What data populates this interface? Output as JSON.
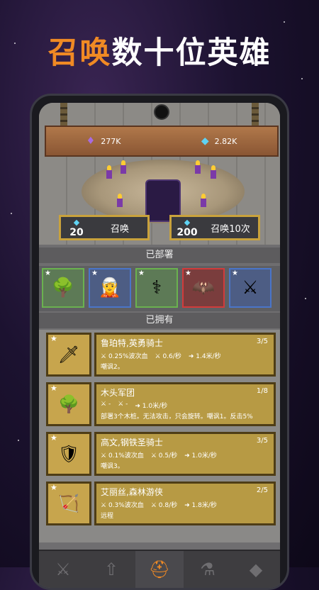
{
  "headline": {
    "accent": "召唤",
    "rest": "数十位英雄"
  },
  "resources": {
    "purple_value": "277K",
    "gem_value": "2.82K"
  },
  "summon": [
    {
      "cost": "20",
      "label": "召唤"
    },
    {
      "cost": "200",
      "label": "召唤10次"
    }
  ],
  "sections": {
    "deployed": "已部署",
    "owned": "已拥有"
  },
  "deployed_slots": [
    {
      "icon": "🌳",
      "border": "#6ab24f",
      "bg": "#5d7a56"
    },
    {
      "icon": "🧝",
      "border": "#4a75c9",
      "bg": "#4d5d84"
    },
    {
      "icon": "⚕",
      "border": "#6ab24f",
      "bg": "#5d7a56"
    },
    {
      "icon": "🦇",
      "border": "#d13b3b",
      "bg": "#7a3d3d"
    },
    {
      "icon": "⚔",
      "border": "#4a75c9",
      "bg": "#4d5d84"
    }
  ],
  "heroes": [
    {
      "icon": "🗡",
      "name": "鲁珀特,英勇骑士",
      "count": "3/5",
      "stat1": "0.25%波次血",
      "stat2": "0.6/秒",
      "stat3": "1.4米/秒",
      "desc": "嘲讽2。"
    },
    {
      "icon": "🌳",
      "name": "木头军团",
      "count": "1/8",
      "stat1": "-",
      "stat2": "-",
      "stat3": "1.0米/秒",
      "desc": "部署3个木桩。无法攻击，只会旋转。嘲讽1。反击5%"
    },
    {
      "icon": "🛡",
      "name": "高文,钢铁圣骑士",
      "count": "3/5",
      "stat1": "0.1%波次血",
      "stat2": "0.5/秒",
      "stat3": "1.0米/秒",
      "desc": "嘲讽3。"
    },
    {
      "icon": "🏹",
      "name": "艾丽丝,森林游侠",
      "count": "2/5",
      "stat1": "0.3%波次血",
      "stat2": "0.8/秒",
      "stat3": "1.8米/秒",
      "desc": "远程"
    }
  ],
  "nav": [
    {
      "icon": "⚔",
      "name": "nav-weapon"
    },
    {
      "icon": "⇧",
      "name": "nav-upgrade"
    },
    {
      "icon": "⛑",
      "name": "nav-heroes"
    },
    {
      "icon": "⚗",
      "name": "nav-potion"
    },
    {
      "icon": "◆",
      "name": "nav-gem"
    }
  ]
}
